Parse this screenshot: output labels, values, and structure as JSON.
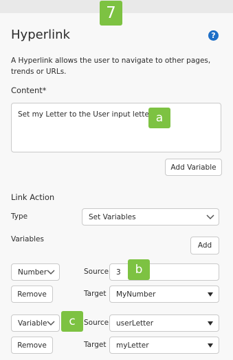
{
  "step_callout": "7",
  "panel": {
    "title": "Hyperlink",
    "help_icon": "help-circle-icon",
    "description": "A Hyperlink allows the user to navigate to other pages, trends or URLs."
  },
  "content": {
    "label": "Content*",
    "value": "Set my Letter to the User input letter",
    "callout": "a",
    "add_variable_label": "Add Variable"
  },
  "link_action": {
    "heading": "Link Action",
    "type_label": "Type",
    "type_value": "Set Variables",
    "variables_label": "Variables",
    "add_label": "Add"
  },
  "variables": [
    {
      "kind": "Number",
      "source_label": "Source",
      "source_value": "3",
      "callout": "b",
      "remove_label": "Remove",
      "target_label": "Target",
      "target_value": "MyNumber"
    },
    {
      "kind": "Variable",
      "source_label": "Source",
      "source_value": "userLetter",
      "callout": "c",
      "remove_label": "Remove",
      "target_label": "Target",
      "target_value": "myLetter"
    }
  ],
  "colors": {
    "callout": "#7dc242",
    "help": "#1e6fc7",
    "background": "#f8f8f8"
  }
}
